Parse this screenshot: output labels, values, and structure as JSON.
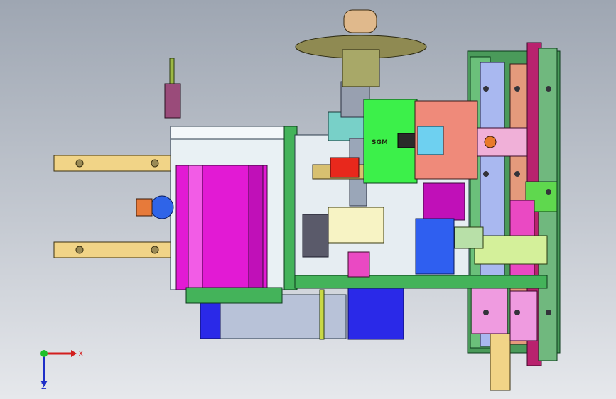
{
  "viewport": {
    "background_top": "#9ea6b2",
    "background_bottom": "#e6e8ec"
  },
  "model": {
    "motor_label": "SGM",
    "colors": {
      "motor_magenta": "#e21ad4",
      "base_plate": "#44b35a",
      "frame_light": "#e9f1f4",
      "servo_green": "#3cf04a",
      "carriage_peach": "#ef8a7a",
      "rail_blue": "#a9b8f0",
      "rail_salmon": "#e49a7c",
      "handwheel_olive": "#8f8a52",
      "guide_bar_tan": "#f1d487",
      "gear_red": "#e8281c",
      "blue_block": "#2f5ff0",
      "cylinder_blue": "#2a29e8",
      "bracket_yellowgreen": "#d4f09a"
    }
  },
  "triad": {
    "x_label": "X",
    "z_label": "Z",
    "x_color": "#d21e1e",
    "y_color": "#1fbf2a",
    "z_color": "#1e2ec8"
  }
}
